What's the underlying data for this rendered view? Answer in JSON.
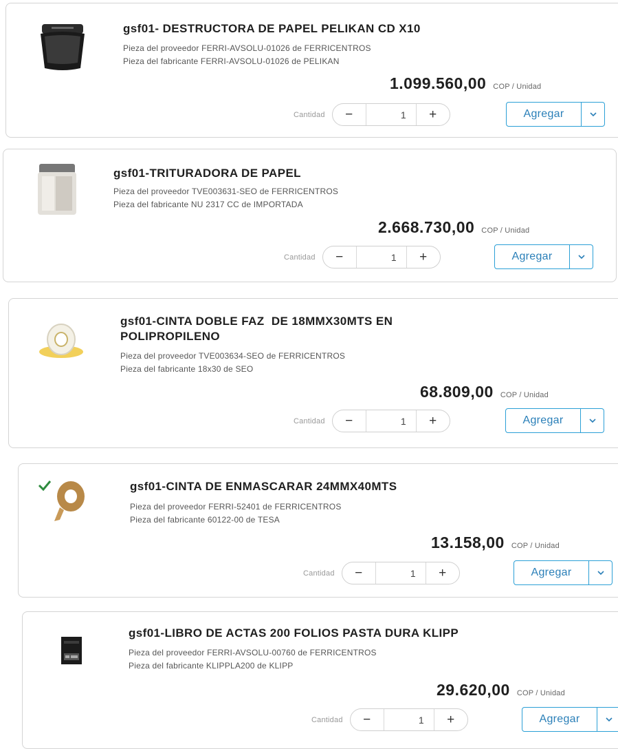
{
  "qty_label": "Cantidad",
  "unit_label": "COP / Unidad",
  "add_label": "Agregar",
  "minus_symbol": "−",
  "plus_symbol": "+",
  "products": [
    {
      "title": "gsf01- DESTRUCTORA DE PAPEL PELIKAN CD X10",
      "supplier_part": "Pieza del proveedor FERRI-AVSOLU-01026 de FERRICENTROS",
      "maker_part": "Pieza del fabricante FERRI-AVSOLU-01026 de PELIKAN",
      "price": "1.099.560,00",
      "quantity": "1",
      "image": "paper-shredder-image"
    },
    {
      "title": "gsf01-TRITURADORA DE PAPEL",
      "supplier_part": "Pieza del proveedor TVE003631-SEO de FERRICENTROS",
      "maker_part": "Pieza del fabricante NU 2317 CC de IMPORTADA",
      "price": "2.668.730,00",
      "quantity": "1",
      "image": "shredder-image"
    },
    {
      "title": "gsf01-CINTA DOBLE FAZ  DE 18MMX30MTS EN\nPOLIPROPILENO",
      "supplier_part": "Pieza del proveedor TVE003634-SEO de FERRICENTROS",
      "maker_part": "Pieza del fabricante 18x30 de SEO",
      "price": "68.809,00",
      "quantity": "1",
      "image": "double-sided-tape-image"
    },
    {
      "title": "gsf01-CINTA DE ENMASCARAR 24MMX40MTS",
      "supplier_part": "Pieza del proveedor FERRI-52401 de FERRICENTROS",
      "maker_part": "Pieza del fabricante 60122-00 de TESA",
      "price": "13.158,00",
      "quantity": "1",
      "image": "masking-tape-image"
    },
    {
      "title": "gsf01-LIBRO DE ACTAS 200 FOLIOS PASTA DURA KLIPP",
      "supplier_part": "Pieza del proveedor FERRI-AVSOLU-00760 de FERRICENTROS",
      "maker_part": "Pieza del fabricante KLIPPLA200 de KLIPP",
      "price": "29.620,00",
      "quantity": "1",
      "image": "minutes-book-image"
    }
  ]
}
